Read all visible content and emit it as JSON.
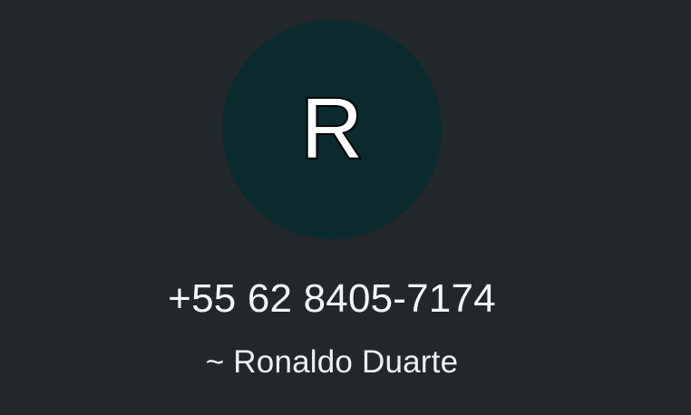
{
  "contact": {
    "avatar_initial": "R",
    "avatar_color": "#0b2a2e",
    "phone": "+55 62 8405-7174",
    "display_name": "~ Ronaldo Duarte"
  },
  "theme": {
    "background": "#21272b",
    "text": "#f4f6f6"
  }
}
